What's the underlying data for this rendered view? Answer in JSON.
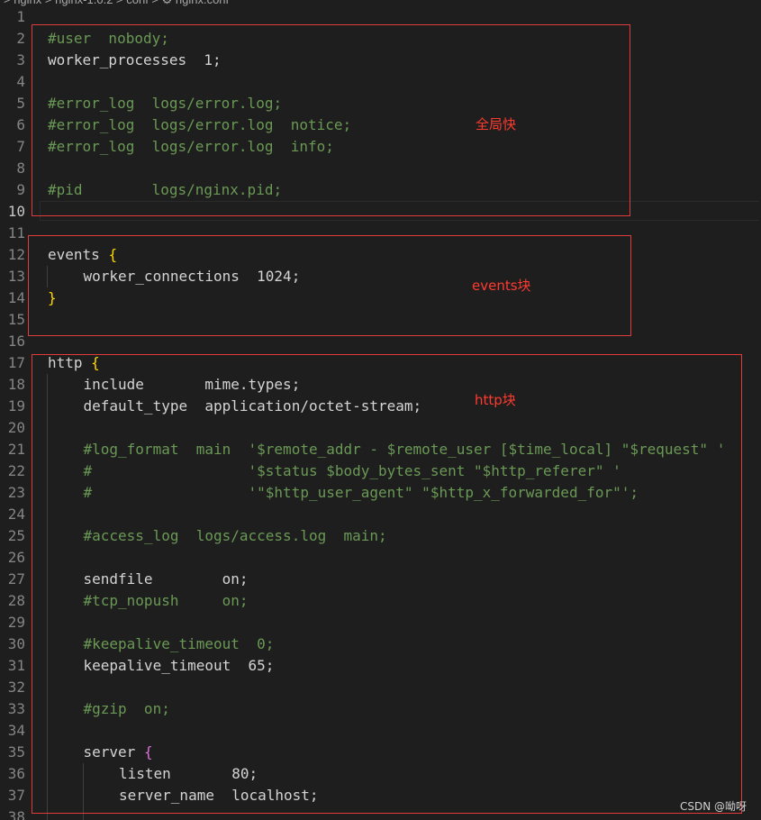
{
  "editor": {
    "breadcrumb": "> nginx > nginx-1.0.2 > conf > ⚙ nginx.conf",
    "current_line": 10
  },
  "lines": [
    {
      "n": "1",
      "text": "",
      "type": "plain",
      "indent": 0
    },
    {
      "n": "2",
      "text": "#user  nobody;",
      "type": "comment",
      "indent": 0
    },
    {
      "n": "3",
      "text": "worker_processes  1;",
      "type": "plain",
      "indent": 0
    },
    {
      "n": "4",
      "text": "",
      "type": "plain",
      "indent": 0
    },
    {
      "n": "5",
      "text": "#error_log  logs/error.log;",
      "type": "comment",
      "indent": 0
    },
    {
      "n": "6",
      "text": "#error_log  logs/error.log  notice;",
      "type": "comment",
      "indent": 0
    },
    {
      "n": "7",
      "text": "#error_log  logs/error.log  info;",
      "type": "comment",
      "indent": 0
    },
    {
      "n": "8",
      "text": "",
      "type": "plain",
      "indent": 0
    },
    {
      "n": "9",
      "text": "#pid        logs/nginx.pid;",
      "type": "comment",
      "indent": 0
    },
    {
      "n": "10",
      "text": "",
      "type": "plain",
      "indent": 0
    },
    {
      "n": "11",
      "text": "",
      "type": "plain",
      "indent": 0
    },
    {
      "n": "12",
      "text": "events ",
      "type": "plain",
      "indent": 0,
      "brace": "{",
      "brace_type": "brace"
    },
    {
      "n": "13",
      "text": "worker_connections  1024;",
      "type": "plain",
      "indent": 1
    },
    {
      "n": "14",
      "text": "",
      "type": "plain",
      "indent": 0,
      "brace": "}",
      "brace_type": "brace"
    },
    {
      "n": "15",
      "text": "",
      "type": "plain",
      "indent": 0
    },
    {
      "n": "16",
      "text": "",
      "type": "plain",
      "indent": 0
    },
    {
      "n": "17",
      "text": "http ",
      "type": "plain",
      "indent": 0,
      "brace": "{",
      "brace_type": "brace"
    },
    {
      "n": "18",
      "text": "include       mime.types;",
      "type": "plain",
      "indent": 1
    },
    {
      "n": "19",
      "text": "default_type  application/octet-stream;",
      "type": "plain",
      "indent": 1
    },
    {
      "n": "20",
      "text": "",
      "type": "plain",
      "indent": 1
    },
    {
      "n": "21",
      "text": "#log_format  main  '$remote_addr - $remote_user [$time_local] \"$request\" '",
      "type": "comment",
      "indent": 1
    },
    {
      "n": "22",
      "text": "#                  '$status $body_bytes_sent \"$http_referer\" '",
      "type": "comment",
      "indent": 1
    },
    {
      "n": "23",
      "text": "#                  '\"$http_user_agent\" \"$http_x_forwarded_for\"';",
      "type": "comment",
      "indent": 1
    },
    {
      "n": "24",
      "text": "",
      "type": "plain",
      "indent": 1
    },
    {
      "n": "25",
      "text": "#access_log  logs/access.log  main;",
      "type": "comment",
      "indent": 1
    },
    {
      "n": "26",
      "text": "",
      "type": "plain",
      "indent": 1
    },
    {
      "n": "27",
      "text": "sendfile        on;",
      "type": "plain",
      "indent": 1
    },
    {
      "n": "28",
      "text": "#tcp_nopush     on;",
      "type": "comment",
      "indent": 1
    },
    {
      "n": "29",
      "text": "",
      "type": "plain",
      "indent": 1
    },
    {
      "n": "30",
      "text": "#keepalive_timeout  0;",
      "type": "comment",
      "indent": 1
    },
    {
      "n": "31",
      "text": "keepalive_timeout  65;",
      "type": "plain",
      "indent": 1
    },
    {
      "n": "32",
      "text": "",
      "type": "plain",
      "indent": 1
    },
    {
      "n": "33",
      "text": "#gzip  on;",
      "type": "comment",
      "indent": 1
    },
    {
      "n": "34",
      "text": "",
      "type": "plain",
      "indent": 1
    },
    {
      "n": "35",
      "text": "server ",
      "type": "plain",
      "indent": 1,
      "brace": "{",
      "brace_type": "brace2"
    },
    {
      "n": "36",
      "text": "listen       80;",
      "type": "plain",
      "indent": 2
    },
    {
      "n": "37",
      "text": "server_name  localhost;",
      "type": "plain",
      "indent": 2
    },
    {
      "n": "38",
      "text": "",
      "type": "plain",
      "indent": 2
    }
  ],
  "annotations": {
    "global_label": "全局快",
    "events_label": "events块",
    "http_label": "http块"
  },
  "watermark": "CSDN @呦呀",
  "colors": {
    "background": "#1e1e1e",
    "comment": "#6a9955",
    "text": "#d4d4d4",
    "brace": "#ffd700",
    "brace_nested": "#da70d6",
    "annotation": "#e03c3c",
    "line_number": "#858585"
  }
}
